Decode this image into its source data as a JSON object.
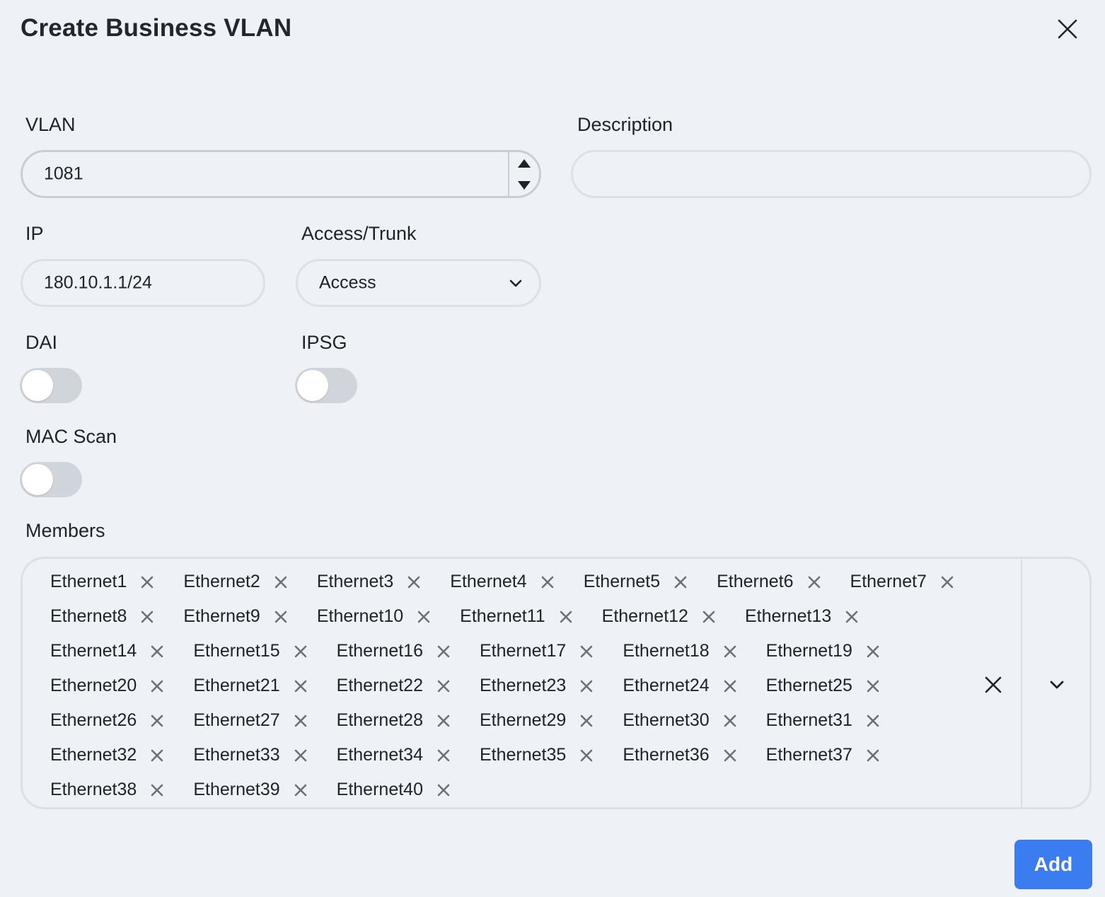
{
  "dialog": {
    "title": "Create Business VLAN",
    "close_icon": "close-icon"
  },
  "form": {
    "vlan": {
      "label": "VLAN",
      "value": "1081"
    },
    "description": {
      "label": "Description",
      "value": ""
    },
    "ip": {
      "label": "IP",
      "value": "180.10.1.1/24"
    },
    "access_trunk": {
      "label": "Access/Trunk",
      "selected": "Access"
    },
    "dai": {
      "label": "DAI",
      "enabled": false
    },
    "ipsg": {
      "label": "IPSG",
      "enabled": false
    },
    "mac_scan": {
      "label": "MAC Scan",
      "enabled": false
    },
    "members": {
      "label": "Members",
      "rows": [
        [
          "Ethernet1",
          "Ethernet2",
          "Ethernet3",
          "Ethernet4",
          "Ethernet5",
          "Ethernet6",
          "Ethernet7"
        ],
        [
          "Ethernet8",
          "Ethernet9",
          "Ethernet10",
          "Ethernet11",
          "Ethernet12",
          "Ethernet13"
        ],
        [
          "Ethernet14",
          "Ethernet15",
          "Ethernet16",
          "Ethernet17",
          "Ethernet18",
          "Ethernet19"
        ],
        [
          "Ethernet20",
          "Ethernet21",
          "Ethernet22",
          "Ethernet23",
          "Ethernet24",
          "Ethernet25"
        ],
        [
          "Ethernet26",
          "Ethernet27",
          "Ethernet28",
          "Ethernet29",
          "Ethernet30",
          "Ethernet31"
        ],
        [
          "Ethernet32",
          "Ethernet33",
          "Ethernet34",
          "Ethernet35",
          "Ethernet36",
          "Ethernet37"
        ],
        [
          "Ethernet38",
          "Ethernet39",
          "Ethernet40"
        ]
      ]
    }
  },
  "actions": {
    "add_label": "Add"
  },
  "colors": {
    "background": "#eef1f6",
    "primary": "#3b7cf0",
    "toggle_off": "#d0d5dc",
    "border": "#dde1e7"
  }
}
